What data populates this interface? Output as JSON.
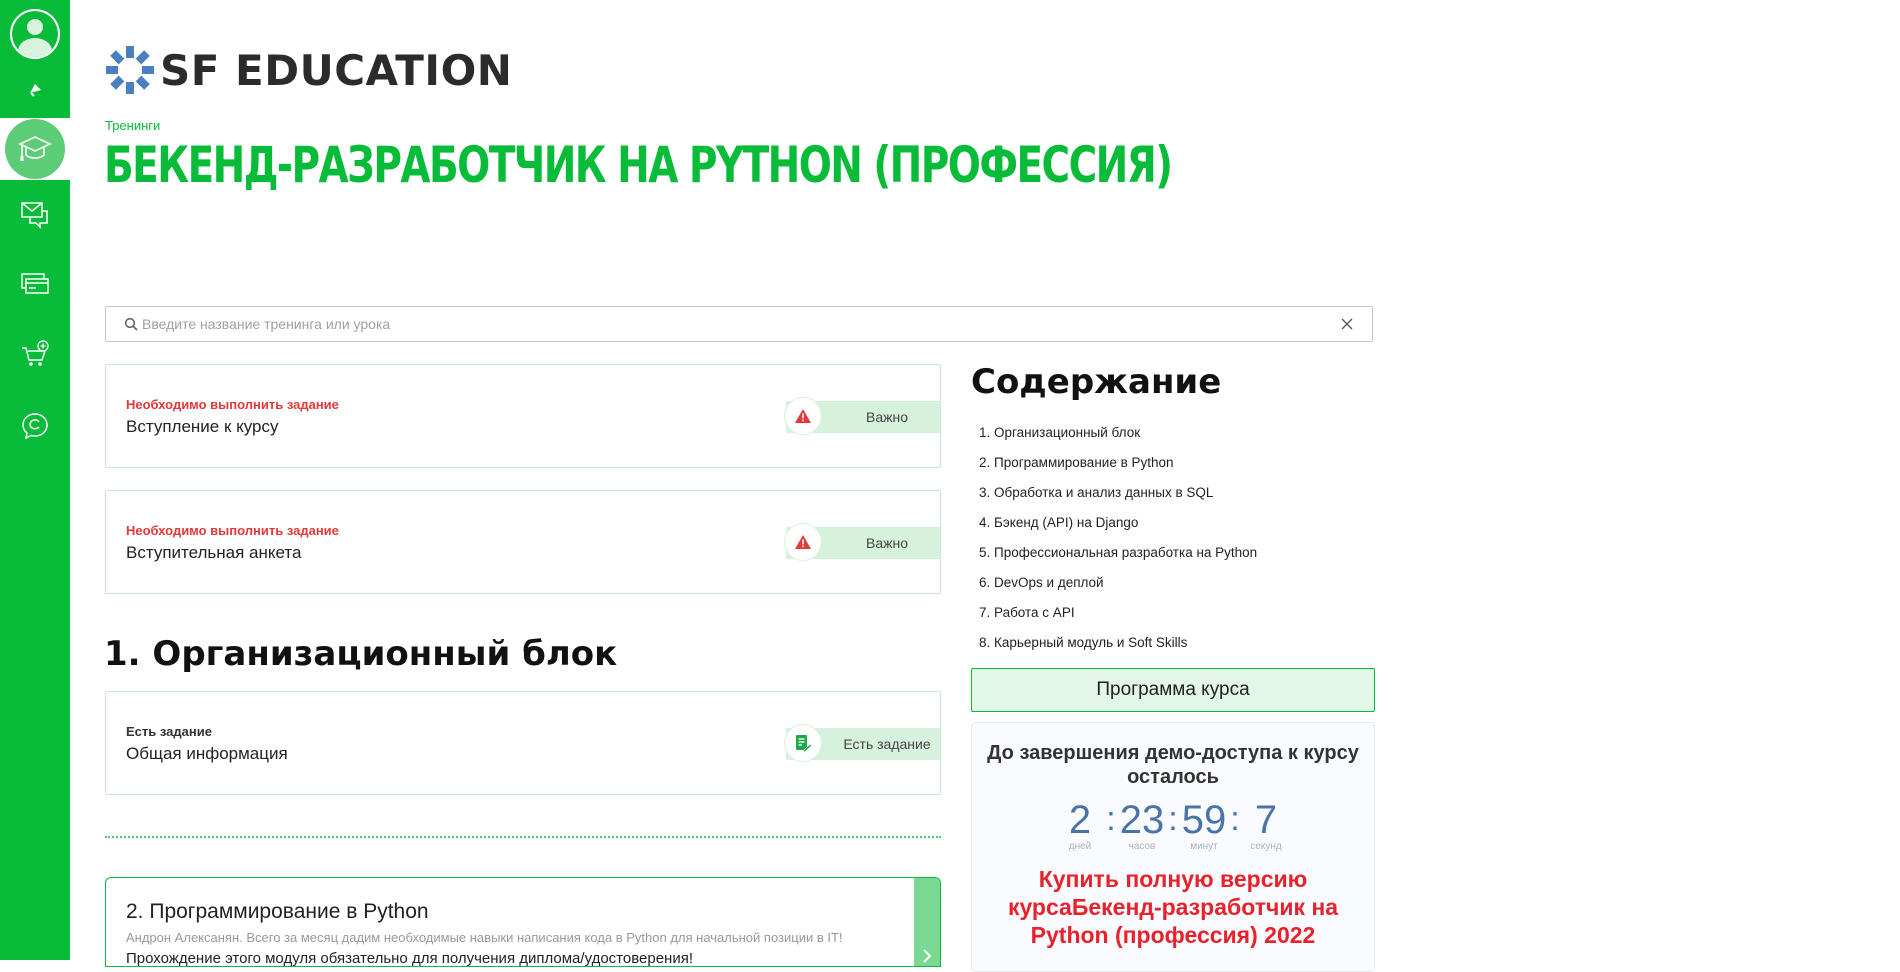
{
  "sidebar": {
    "items": [
      {
        "name": "notifications",
        "icon": "bell-icon"
      },
      {
        "name": "trainings",
        "icon": "graduation-cap-icon",
        "active": true
      },
      {
        "name": "messages",
        "icon": "mail-chat-icon"
      },
      {
        "name": "payments",
        "icon": "credit-cards-icon"
      },
      {
        "name": "shop",
        "icon": "cart-plus-icon"
      },
      {
        "name": "support",
        "icon": "chat-bubble-icon"
      }
    ],
    "color": "#08bc3a"
  },
  "logo": {
    "text": "SF EDUCATION"
  },
  "breadcrumb": "Тренинги",
  "page_title": "БЕКЕНД-РАЗРАБОТЧИК НА PYTHON (ПРОФЕССИЯ)",
  "search": {
    "placeholder": "Введите название тренинга или урока",
    "value": ""
  },
  "required_cards": [
    {
      "status": "Необходимо выполнить задание",
      "title": "Вступление к курсу",
      "badge": "Важно"
    },
    {
      "status": "Необходимо выполнить задание",
      "title": "Вступительная анкета",
      "badge": "Важно"
    }
  ],
  "section1": {
    "title": "1. Организационный блок",
    "card": {
      "status": "Есть задание",
      "title": "Общая информация",
      "badge": "Есть задание"
    }
  },
  "module2": {
    "title": "2. Программирование в Python",
    "desc": "Андрон Алексанян. Всего за месяц дадим необходимые навыки написания кода в Python для начальной позиции в IT!",
    "desc2": "Прохождение этого модуля обязательно для получения диплома/удостоверения!"
  },
  "toc": {
    "title": "Содержание",
    "items": [
      "1. Организационный блок",
      "2. Программирование в Python",
      "3. Обработка и анализ данных в SQL",
      "4. Бэкенд (API) на Django",
      "5. Профессиональная разработка на Python",
      "6. DevOps и деплой",
      "7. Работа с API",
      "8. Карьерный модуль и Soft Skills"
    ]
  },
  "program_button": "Программа курса",
  "demo": {
    "title": "До завершения демо-доступа к курсу осталось",
    "timer": [
      {
        "value": "2",
        "label": "дней"
      },
      {
        "value": "23",
        "label": "часов"
      },
      {
        "value": "59",
        "label": "минут"
      },
      {
        "value": "7",
        "label": "секунд"
      }
    ],
    "buy_text": "Купить полную версию курсаБекенд-разработчик на Python (профессия) 2022"
  },
  "colors": {
    "accent": "#08bc3a",
    "warning": "#e23a3a",
    "timer": "#4a74a8",
    "buy": "#e8222c"
  }
}
